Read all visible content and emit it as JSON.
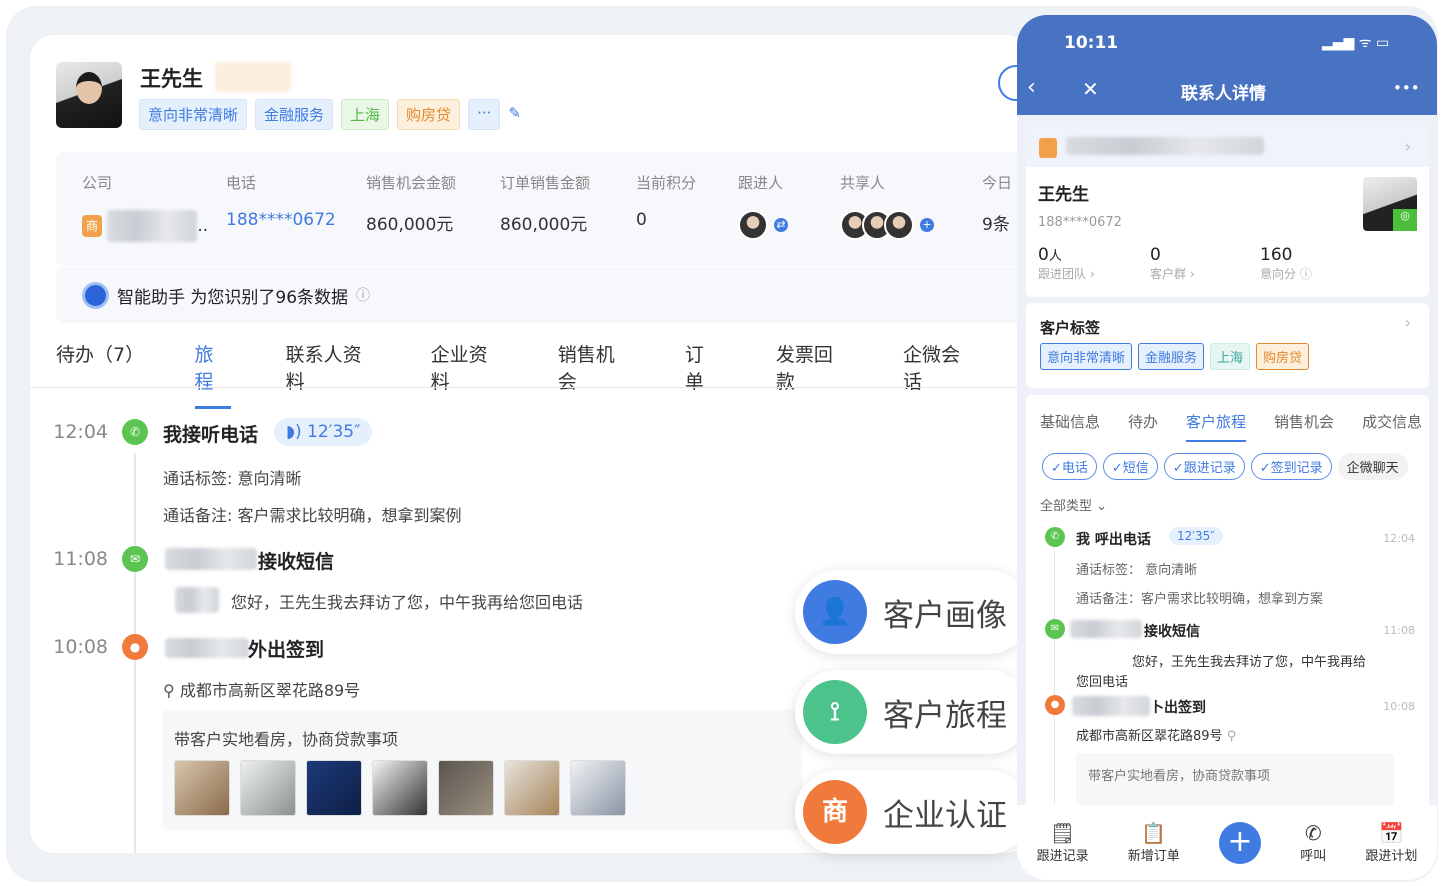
{
  "contact": {
    "name": "王先生",
    "tags": [
      "意向非常清晰",
      "金融服务",
      "上海",
      "购房贷"
    ],
    "more": "···",
    "edit_icon": "pencil"
  },
  "stats": {
    "labels": [
      "公司",
      "电话",
      "销售机会金额",
      "订单销售金额",
      "当前积分",
      "跟进人",
      "共享人",
      "今日"
    ],
    "company_suffix": "..",
    "phone": "188****0672",
    "opportunity": "860,000元",
    "order": "860,000元",
    "points": "0",
    "today": "9条"
  },
  "assistant": {
    "text": "智能助手 为您识别了96条数据"
  },
  "tabs": [
    {
      "label": "待办（7）"
    },
    {
      "label": "旅程"
    },
    {
      "label": "联系人资料"
    },
    {
      "label": "企业资料"
    },
    {
      "label": "销售机会"
    },
    {
      "label": "订单"
    },
    {
      "label": "发票回款"
    },
    {
      "label": "企微会话"
    }
  ],
  "timeline": [
    {
      "time": "12:04",
      "title": "我接听电话",
      "duration": "12′35″",
      "lines": [
        "通话标签: 意向清晰",
        "通话备注: 客户需求比较明确，想拿到案例"
      ]
    },
    {
      "time": "11:08",
      "title": "接收短信",
      "lines": [
        "您好，王先生我去拜访了您，中午我再给您回电话"
      ]
    },
    {
      "time": "10:08",
      "title": "外出签到",
      "address": "成都市高新区翠花路89号",
      "note": "带客户实地看房，协商贷款事项"
    }
  ],
  "floats": [
    {
      "label": "客户画像"
    },
    {
      "label": "客户旅程"
    },
    {
      "label": "企业认证",
      "icon": "商"
    }
  ],
  "phone": {
    "time": "10:11",
    "title": "联系人详情",
    "more": "•••",
    "name": "王先生",
    "phone": "188****0672",
    "metrics": [
      {
        "value": "0",
        "unit": "人",
        "label": "跟进团队 ›"
      },
      {
        "value": "0",
        "label": "客户群 ›"
      },
      {
        "value": "160",
        "label": "意向分 ⓘ"
      }
    ],
    "tag_title": "客户标签",
    "tags": [
      "意向非常清晰",
      "金融服务",
      "上海",
      "购房贷"
    ],
    "tabs": [
      "基础信息",
      "待办",
      "客户旅程",
      "销售机会",
      "成交信息"
    ],
    "chips": [
      "✓电话",
      "✓短信",
      "✓跟进记录",
      "✓签到记录",
      "企微聊天"
    ],
    "filter": "全部类型 ⌄",
    "timeline": [
      {
        "title": "我 呼出电话",
        "duration": "12′35″",
        "time": "12:04",
        "lines": [
          "通话标签：  意向清晰",
          "通话备注：客户需求比较明确，想拿到方案"
        ]
      },
      {
        "title": "接收短信",
        "time": "11:08",
        "lines": [
          "您好，王先生我去拜访了您，中午我再给",
          "您回电话"
        ]
      },
      {
        "title": "卜出签到",
        "time": "10:08",
        "address": "成都市高新区翠花路89号",
        "note": "带客户实地看房，协商贷款事项"
      }
    ],
    "bar": [
      "跟进记录",
      "新增订单",
      "呼叫",
      "跟进计划"
    ]
  }
}
